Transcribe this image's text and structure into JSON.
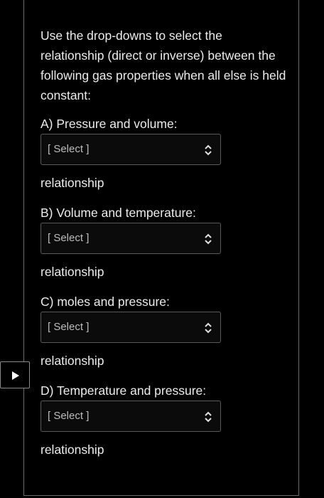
{
  "question": {
    "prompt": "Use the drop-downs to select the relationship (direct or inverse) between the following gas properties when all else is held constant:"
  },
  "items": [
    {
      "label": "A)  Pressure and volume:",
      "select": "[ Select ]",
      "suffix": "relationship"
    },
    {
      "label": "B)  Volume and temperature:",
      "select": "[ Select ]",
      "suffix": "relationship"
    },
    {
      "label": "C)  moles and pressure:",
      "select": "[ Select ]",
      "suffix": "relationship"
    },
    {
      "label": "D) Temperature and pressure:",
      "select": "[ Select ]",
      "suffix": "relationship"
    }
  ],
  "icons": {
    "select_indicator": "chevron-up-down-icon",
    "play": "play-icon"
  },
  "colors": {
    "background": "#000000",
    "text": "#ececec",
    "border": "#5a5a5a"
  }
}
